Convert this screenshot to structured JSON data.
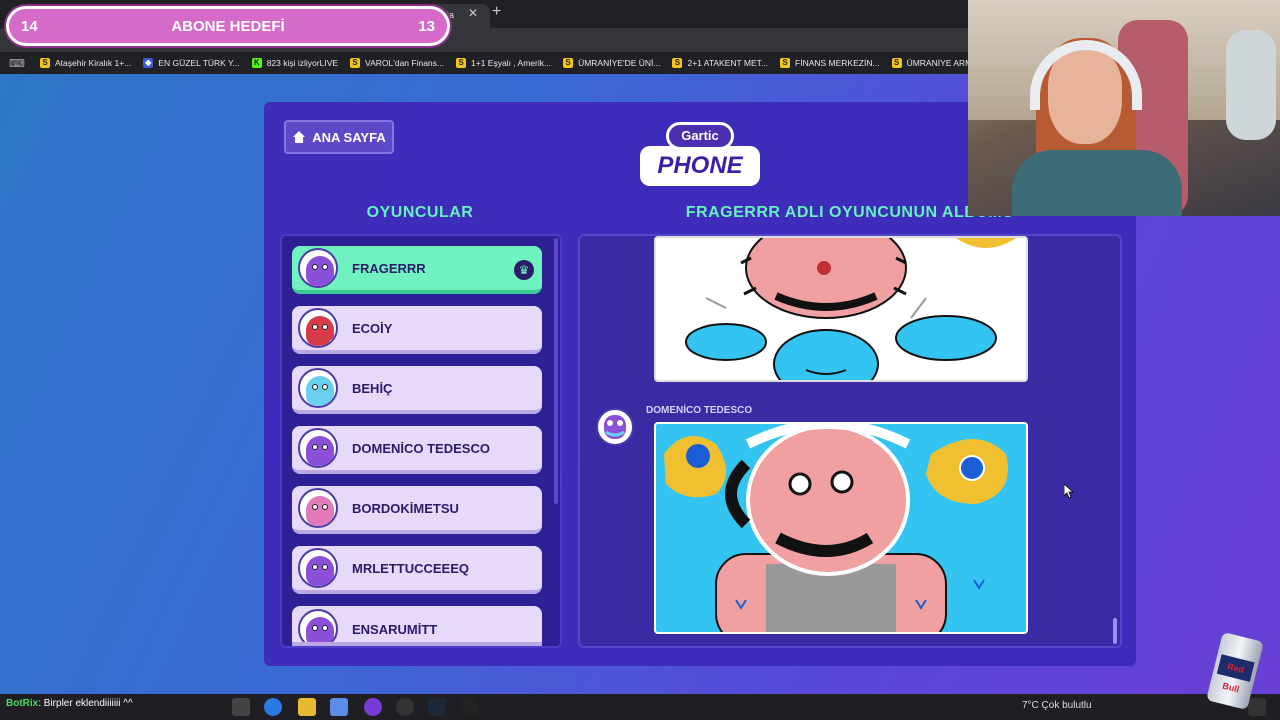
{
  "browser": {
    "tab_partial_label": "ğa",
    "tab_close": "✕",
    "tab_new": "+",
    "bookmarks_menu": "⌨",
    "bookmarks": [
      {
        "icon": "S",
        "label": "Ataşehir Kiralık 1+..."
      },
      {
        "icon": "◆",
        "label": "EN GÜZEL TÜRK Y..."
      },
      {
        "icon": "K",
        "label": "823 kişi izliyorLIVE"
      },
      {
        "icon": "S",
        "label": "VAROL'dan Finans..."
      },
      {
        "icon": "S",
        "label": "1+1 Eşyalı , Amerik..."
      },
      {
        "icon": "S",
        "label": "ÜMRANİYE'DE ÜNİ..."
      },
      {
        "icon": "S",
        "label": "2+1 ATAKENT MET..."
      },
      {
        "icon": "S",
        "label": "FİNANS MERKEZİN..."
      },
      {
        "icon": "S",
        "label": "ÜMRANİYE ARMA..."
      },
      {
        "icon": "S",
        "label": ""
      }
    ]
  },
  "stream": {
    "goal_left": "14",
    "goal_title": "ABONE HEDEFİ",
    "goal_right": "13"
  },
  "game": {
    "home_label": "ANA SAYFA",
    "logo_top": "Gartic",
    "logo_bottom": "PHONE",
    "players_title": "OYUNCULAR",
    "album_title": "FRAGERRR ADLI OYUNCUNUN ALBÜMÜ",
    "players": [
      {
        "name": "FRAGERRR",
        "active": true,
        "color": "#8b4fd8"
      },
      {
        "name": "ECOİY",
        "active": false,
        "color": "#d83a4a"
      },
      {
        "name": "BEHİÇ",
        "active": false,
        "color": "#6ad0f0"
      },
      {
        "name": "DOMENİCO TEDESCO",
        "active": false,
        "color": "#8b4fd8"
      },
      {
        "name": "BORDOKİMETSU",
        "active": false,
        "color": "#e07ab8"
      },
      {
        "name": "MRLETTUCCEEEQ",
        "active": false,
        "color": "#8b4fd8"
      },
      {
        "name": "ENSARUMİTT",
        "active": false,
        "color": "#8b4fd8"
      }
    ],
    "crown_icon": "♛",
    "author_name": "DOMENİCO TEDESCO"
  },
  "taskbar": {
    "botrix_name": "BotRix",
    "botrix_msg": ": Birpler eklendiiiiiii ^^",
    "weather": "7°C  Çok bulutlu",
    "redbull_label": "Red Bull"
  },
  "colors": {
    "accent_green": "#66f0c0",
    "panel": "#3d2bb8",
    "goal_pink": "#d66ac9"
  }
}
